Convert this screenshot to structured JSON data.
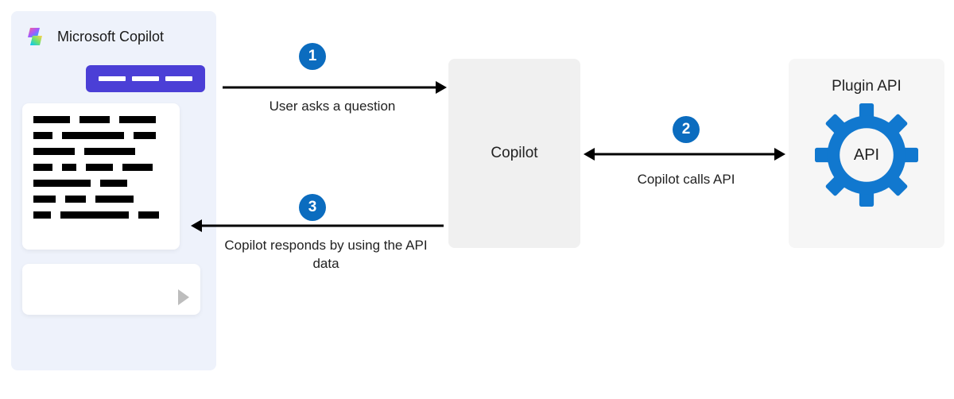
{
  "panel": {
    "title": "Microsoft Copilot"
  },
  "copilot_box_label": "Copilot",
  "plugin_box": {
    "title": "Plugin API",
    "center_text": "API"
  },
  "steps": {
    "s1": {
      "num": "1",
      "label": "User asks a question"
    },
    "s2": {
      "num": "2",
      "label": "Copilot calls API"
    },
    "s3": {
      "num": "3",
      "label": "Copilot responds by using the API data"
    }
  },
  "colors": {
    "accent_blue": "#0b6cbf",
    "user_bubble": "#4b3fd6"
  }
}
